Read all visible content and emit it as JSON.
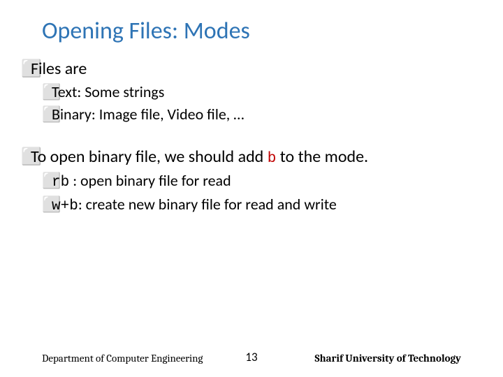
{
  "title": "Opening Files: Modes",
  "bullet_char": "⬜",
  "body": {
    "p1": "Files are",
    "p1a": "Text: Some strings",
    "p1b": "Binary: Image file, Video file, …",
    "p2_pre": "To open binary file, we should add ",
    "p2_code": "b",
    "p2_post": " to the mode.",
    "p2a_code": "rb",
    "p2a_text": " : open binary file for read",
    "p2b_code": "w+b",
    "p2b_text": ": create new binary file for read and write"
  },
  "footer": {
    "left": "Department of Computer Engineering",
    "center": "13",
    "right": "Sharif University of Technology"
  }
}
